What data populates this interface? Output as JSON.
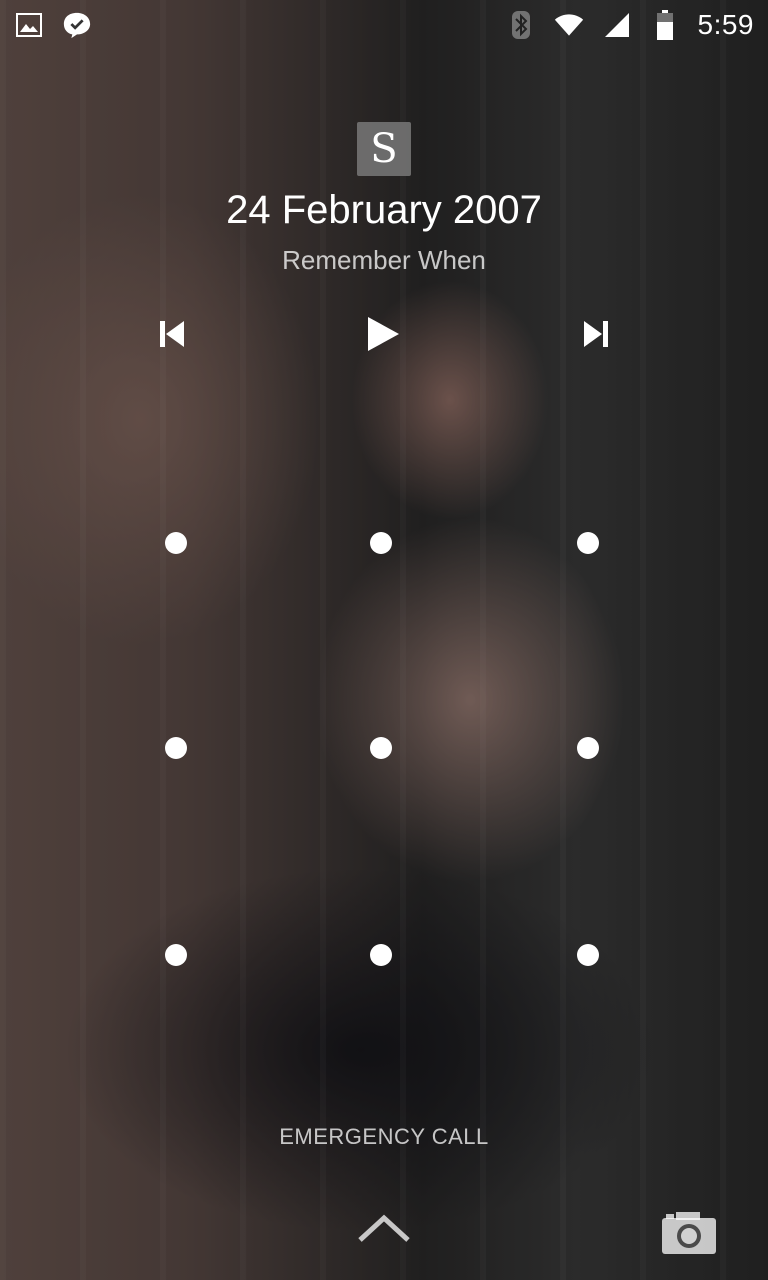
{
  "status_bar": {
    "time": "5:59",
    "left_icons": [
      "image-notification-icon",
      "check-chat-notification-icon"
    ],
    "right_icons": [
      "bluetooth-icon",
      "wifi-icon",
      "cell-signal-icon",
      "battery-icon"
    ]
  },
  "lockscreen": {
    "owner_initial": "S",
    "date": "24 February 2007",
    "track_title": "Remember When",
    "emergency_label": "EMERGENCY CALL"
  },
  "media_controls": [
    "previous-track-icon",
    "play-icon",
    "next-track-icon"
  ],
  "pattern": {
    "rows": 3,
    "cols": 3
  }
}
